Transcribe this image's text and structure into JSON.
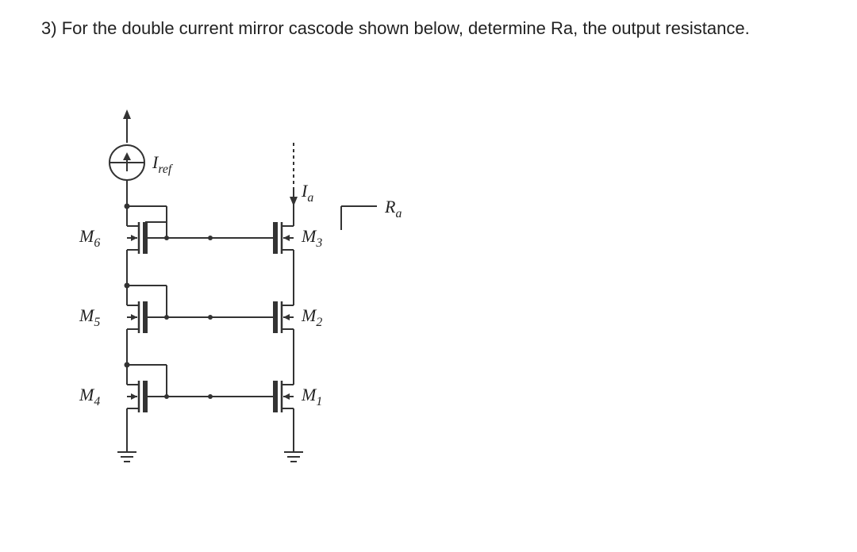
{
  "question": {
    "number": "3)",
    "text": "For the double current mirror cascode shown below, determine Ra, the output resistance."
  },
  "circuit_labels": {
    "Iref": "I",
    "Iref_sub": "ref",
    "Ia": "I",
    "Ia_sub": "a",
    "Ra": "R",
    "Ra_sub": "a",
    "M6": "M",
    "M6_sub": "6",
    "M5": "M",
    "M5_sub": "5",
    "M4": "M",
    "M4_sub": "4",
    "M3": "M",
    "M3_sub": "3",
    "M2": "M",
    "M2_sub": "2",
    "M1": "M",
    "M1_sub": "1"
  }
}
